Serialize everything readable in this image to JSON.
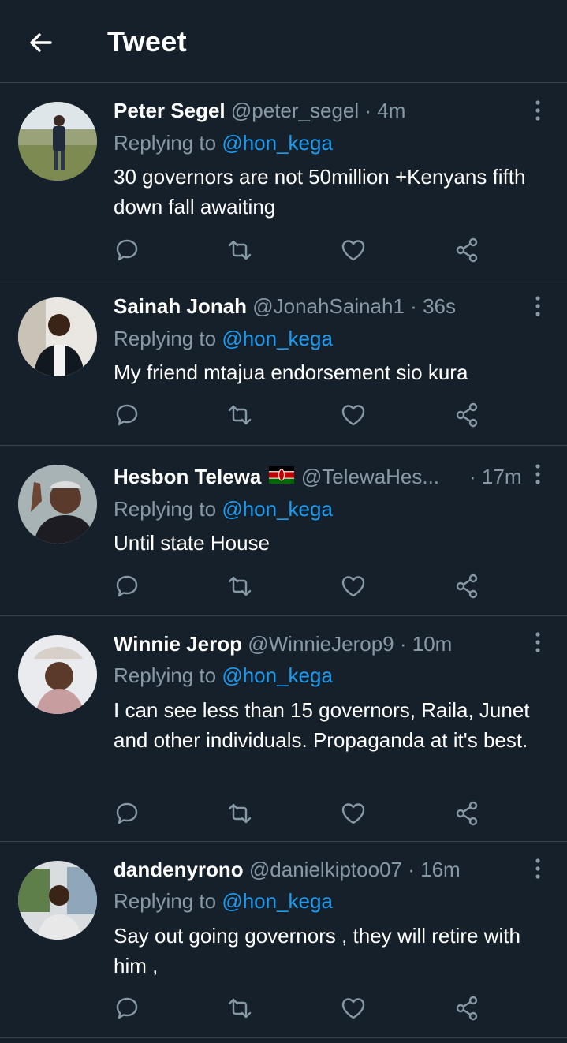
{
  "header": {
    "title": "Tweet"
  },
  "reply_prefix": "Replying to ",
  "tweets": [
    {
      "name": "Peter Segel",
      "handle": "@peter_segel",
      "time": "4m",
      "replying_to": "@hon_kega",
      "text": "30 governors are not 50million +Kenyans fifth down fall awaiting"
    },
    {
      "name": "Sainah Jonah",
      "handle": "@JonahSainah1",
      "time": "36s",
      "replying_to": "@hon_kega",
      "text": "My friend mtajua endorsement sio kura"
    },
    {
      "name": "Hesbon Telewa",
      "flag": "kenya-flag-icon",
      "handle": "@TelewaHes...",
      "time": "17m",
      "replying_to": "@hon_kega",
      "text": "Until state House"
    },
    {
      "name": "Winnie Jerop",
      "handle": "@WinnieJerop9",
      "time": "10m",
      "replying_to": "@hon_kega",
      "text": "I can see less than 15 governors, Raila, Junet and other individuals. Propaganda at it's best."
    },
    {
      "name": "dandenyrono",
      "handle": "@danielkiptoo07",
      "time": "16m",
      "replying_to": "@hon_kega",
      "text": "Say out going governors , they will retire with him ,"
    }
  ],
  "icons": [
    "back-arrow-icon",
    "more-vertical-icon",
    "reply-icon",
    "retweet-icon",
    "like-icon",
    "share-icon"
  ],
  "colors": {
    "background": "#15202b",
    "divider": "#38444d",
    "secondary_text": "#8899a6",
    "link": "#1d9bf0"
  }
}
